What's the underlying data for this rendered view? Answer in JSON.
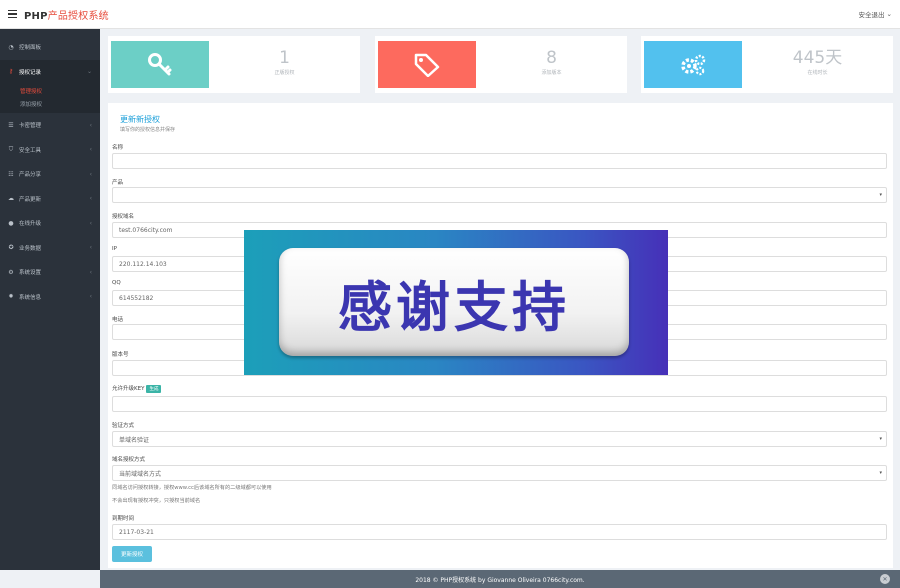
{
  "header": {
    "brand_prefix": "PHP",
    "brand_suffix": "产品授权系统",
    "user_menu": "安全退出"
  },
  "sidebar": {
    "items": [
      {
        "label": "控制面板",
        "icon": "dashboard-icon"
      },
      {
        "label": "授权记录",
        "icon": "key-icon",
        "active": true
      },
      {
        "label": "卡密管理",
        "icon": "list-icon"
      },
      {
        "label": "安全工具",
        "icon": "shield-icon"
      },
      {
        "label": "产品分享",
        "icon": "share-icon"
      },
      {
        "label": "产品更新",
        "icon": "cloud-icon"
      },
      {
        "label": "在线升级",
        "icon": "upgrade-icon"
      },
      {
        "label": "业务数据",
        "icon": "data-icon"
      },
      {
        "label": "系统设置",
        "icon": "gear-icon"
      },
      {
        "label": "系统信息",
        "icon": "info-icon"
      }
    ],
    "sub_items": [
      {
        "label": "管理授权",
        "current": true
      },
      {
        "label": "添加授权"
      }
    ]
  },
  "stats": [
    {
      "value": "1",
      "label": "正版授权",
      "color": "#6ccfc6",
      "icon": "key-icon"
    },
    {
      "value": "8",
      "label": "添加版本",
      "color": "#fd6a5e",
      "icon": "tag-icon"
    },
    {
      "value": "445天",
      "label": "在线时长",
      "color": "#52c1ee",
      "icon": "gears-icon"
    }
  ],
  "form": {
    "title": "更新新授权",
    "subtitle": "填写你的授权信息并保存",
    "fields": {
      "name": {
        "label": "名称",
        "value": ""
      },
      "product": {
        "label": "产品",
        "value": ""
      },
      "domain": {
        "label": "授权域名",
        "value": "test.0766city.com"
      },
      "ip": {
        "label": "IP",
        "value": "220.112.14.103"
      },
      "qq": {
        "label": "QQ",
        "value": "614552182"
      },
      "phone": {
        "label": "电话",
        "value": ""
      },
      "version": {
        "label": "版本号",
        "value": ""
      },
      "upgrade_key": {
        "label": "允许升级KEY",
        "tag": "生成",
        "value": ""
      },
      "verify_method": {
        "label": "验证方式",
        "value": "单域名验证"
      },
      "domain_auth_method": {
        "label": "域名授权方式",
        "value": "当前域域名方式"
      }
    },
    "hint1": "同域名访问授权转接，授权www.cc后该域名所有的二级域都可以使用",
    "hint2": "不会出现有授权冲突，只授权当前域名",
    "expire": {
      "label": "到期时间",
      "value": "2117-03-21"
    },
    "submit_label": "更新授权"
  },
  "overlay": {
    "text": "感谢支持"
  },
  "footer": {
    "text": "2018 © PHP授权系统 by Giovanne Oliveira 0766city.com."
  }
}
